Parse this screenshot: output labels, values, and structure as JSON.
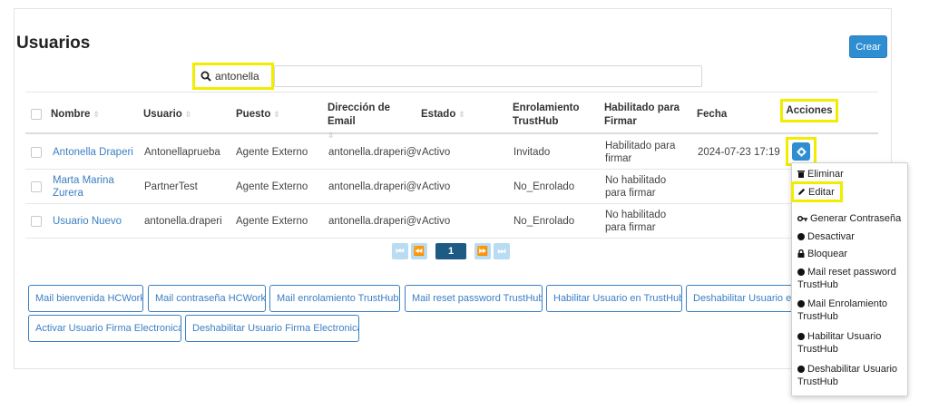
{
  "page": {
    "title": "Usuarios",
    "create_label": "Crear"
  },
  "search": {
    "value": "antonella",
    "icon": "search-icon"
  },
  "table": {
    "headers": {
      "nombre": "Nombre",
      "usuario": "Usuario",
      "puesto": "Puesto",
      "email": "Dirección de Email",
      "estado": "Estado",
      "enrolamiento": "Enrolamiento TrustHub",
      "habilitado": "Habilitado para Firmar",
      "fecha": "Fecha",
      "acciones": "Acciones"
    },
    "rows": [
      {
        "nombre": "Antonella Draperi",
        "usuario": "Antonellaprueba",
        "puesto": "Agente Externo",
        "email": "antonella.draperi@wo",
        "estado": "Activo",
        "enrolamiento": "Invitado",
        "habilitado": "Habilitado para firmar",
        "fecha": "2024-07-23 17:19"
      },
      {
        "nombre": "Marta Marina Zurera",
        "usuario": "PartnerTest",
        "puesto": "Agente Externo",
        "email": "antonella.draperi@wo",
        "estado": "Activo",
        "enrolamiento": "No_Enrolado",
        "habilitado": "No habilitado para firmar",
        "fecha": ""
      },
      {
        "nombre": "Usuario Nuevo",
        "usuario": "antonella.draperi",
        "puesto": "Agente Externo",
        "email": "antonella.draperi@wo",
        "estado": "Activo",
        "enrolamiento": "No_Enrolado",
        "habilitado": "No habilitado para firmar",
        "fecha": ""
      }
    ]
  },
  "pagination": {
    "current": "1",
    "first": "⏮",
    "prev": "⏪",
    "next": "⏩",
    "last": "⏭"
  },
  "action_buttons": {
    "mail_bienvenida": "Mail bienvenida HCWork",
    "mail_contrasena": "Mail contraseña HCWork",
    "mail_enrolamiento": "Mail enrolamiento TrustHub",
    "mail_reset": "Mail reset password TrustHub",
    "habilitar": "Habilitar Usuario en TrustHub",
    "deshabilitar": "Deshabilitar Usuario en",
    "activar_firma": "Activar Usuario Firma Electronica",
    "deshabilitar_firma": "Deshabilitar Usuario Firma Electronica"
  },
  "dropdown": {
    "eliminar": "Eliminar",
    "editar": "Editar",
    "generar": "Generar Contraseña",
    "desactivar": "Desactivar",
    "bloquear": "Bloquear",
    "mail_reset": "Mail reset password TrustHub",
    "mail_enrolamiento": "Mail Enrolamiento TrustHub",
    "habilitar": "Habilitar Usuario TrustHub",
    "deshabilitar": "Deshabilitar Usuario TrustHub"
  },
  "colors": {
    "accent": "#2f8ed2",
    "highlight": "#f2ec00",
    "link": "#3b7fc4"
  }
}
